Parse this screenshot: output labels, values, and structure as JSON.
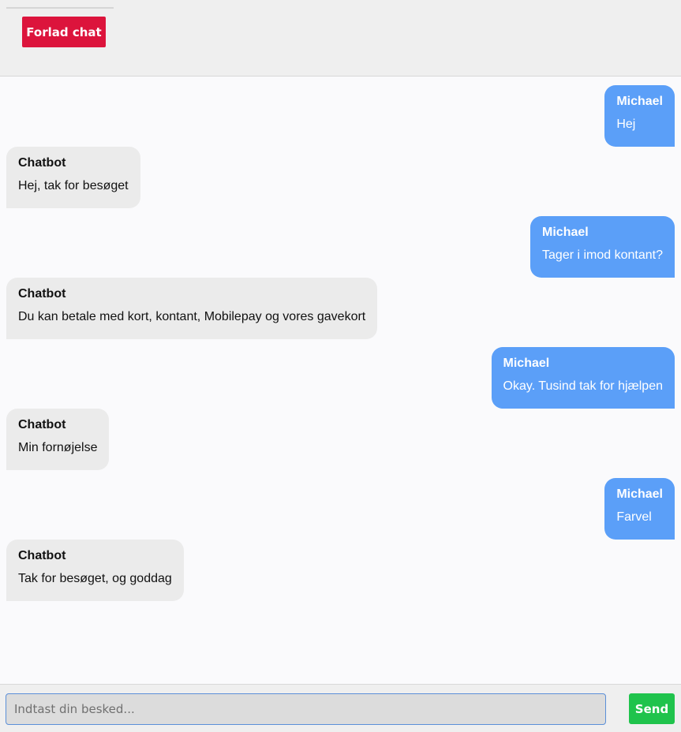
{
  "header": {
    "leave_label": "Forlad chat"
  },
  "messages": [
    {
      "sender": "Michael",
      "text": "Hej"
    },
    {
      "sender": "Chatbot",
      "text": "Hej, tak for besøget"
    },
    {
      "sender": "Michael",
      "text": "Tager i imod kontant?"
    },
    {
      "sender": "Chatbot",
      "text": "Du kan betale med kort, kontant, Mobilepay og vores gavekort"
    },
    {
      "sender": "Michael",
      "text": "Okay. Tusind tak for hjælpen"
    },
    {
      "sender": "Chatbot",
      "text": "Min fornøjelse"
    },
    {
      "sender": "Michael",
      "text": "Farvel"
    },
    {
      "sender": "Chatbot",
      "text": "Tak for besøget, og goddag"
    }
  ],
  "composer": {
    "placeholder": "Indtast din besked...",
    "value": "",
    "send_label": "Send"
  },
  "colors": {
    "leave": "#dc143c",
    "user_bubble": "#5b9ff8",
    "bot_bubble": "#ebebeb",
    "send": "#1fc34c"
  }
}
